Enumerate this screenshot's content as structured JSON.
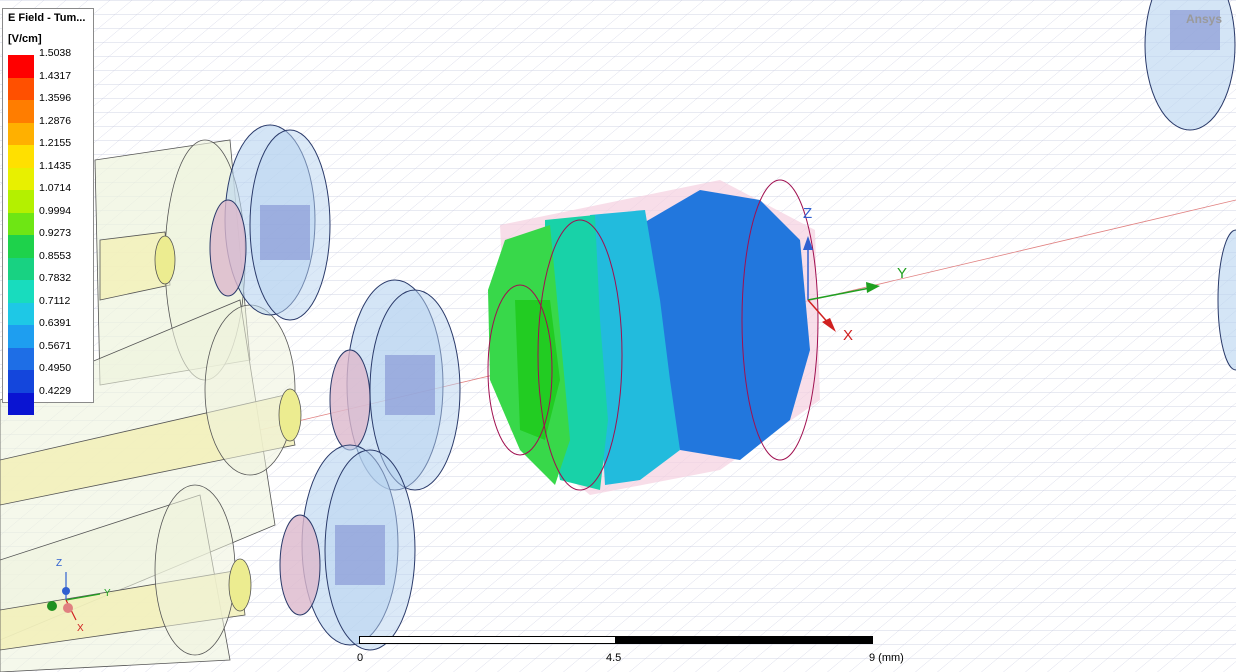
{
  "legend": {
    "title": "E Field - Tum...",
    "unit": "[V/cm]",
    "values": [
      "1.5038",
      "1.4317",
      "1.3596",
      "1.2876",
      "1.2155",
      "1.1435",
      "1.0714",
      "0.9994",
      "0.9273",
      "0.8553",
      "0.7832",
      "0.7112",
      "0.6391",
      "0.5671",
      "0.4950",
      "0.4229"
    ],
    "colors": [
      "#ff0000",
      "#ff5000",
      "#ff7d00",
      "#ffb000",
      "#ffe000",
      "#e8f000",
      "#b4f000",
      "#6ee614",
      "#1ed24b",
      "#18d282",
      "#18dcbe",
      "#1ec8e6",
      "#1e9ef0",
      "#1e6ee6",
      "#1446dc",
      "#0a14d2"
    ]
  },
  "brand": "Ansys",
  "scale_bar": {
    "start": "0",
    "mid": "4.5",
    "end": "9 (mm)"
  },
  "axes": {
    "x": "X",
    "y": "Y",
    "z": "Z"
  },
  "mini_triad": {
    "x": "X",
    "y": "Y",
    "z": "Z"
  }
}
